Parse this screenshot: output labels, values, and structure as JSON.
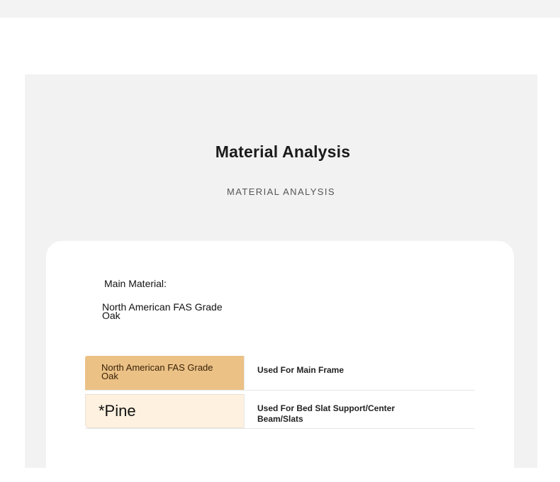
{
  "header": {
    "title": "Material Analysis",
    "subtitle": "MATERIAL ANALYSIS"
  },
  "main_material": {
    "label": "Main Material:",
    "value": "North American FAS Grade Oak"
  },
  "materials_table": [
    {
      "material": "North American FAS Grade Oak",
      "usage": "Used For Main Frame"
    },
    {
      "material": "*Pine",
      "usage": "Used For Bed Slat Support/Center Beam/Slats"
    }
  ],
  "colors": {
    "oak_highlight": "#ebc186",
    "pine_highlight": "#fff1e0",
    "panel_background": "#f2f2f2"
  }
}
